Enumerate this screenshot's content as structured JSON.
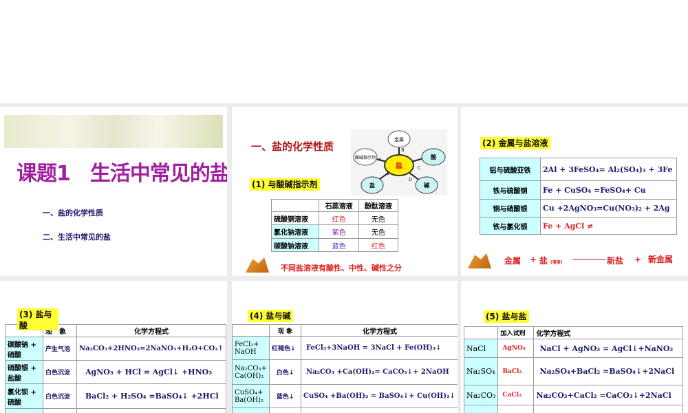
{
  "slide1": {
    "title": "课题1　生活中常见的盐",
    "items": [
      "一、盐的化学性质",
      "二、生活中常见的盐"
    ]
  },
  "slide2": {
    "title": "一、盐的化学性质",
    "label": "(1) 与酸碱指示剂",
    "diagram": {
      "center": "盐",
      "nodes": [
        "金属",
        "酸碱指示剂",
        "酸",
        "盐",
        "碱"
      ],
      "letters": [
        "A",
        "B",
        "C",
        "D",
        "E"
      ]
    },
    "table": {
      "headers": [
        "",
        "石蕊溶液",
        "酚酞溶液"
      ],
      "rows": [
        [
          "硫酸铜溶液",
          "红色",
          "无色"
        ],
        [
          "氯化钠溶液",
          "紫色",
          "无色"
        ],
        [
          "碳酸钠溶液",
          "蓝色",
          "红色"
        ]
      ]
    },
    "footer": "不同盐溶液有酸性、中性、碱性之分"
  },
  "slide3": {
    "label": "(2) 金属与盐溶液",
    "rows": [
      [
        "铝与硫酸亚铁",
        "2Al + 3FeSO₄= Al₂(SO₄)₃ + 3Fe"
      ],
      [
        "铁与硫酸铜",
        "Fe +  CuSO₄ =FeSO₄+   Cu"
      ],
      [
        "铜与硝酸银",
        "Cu +2AgNO₃=Cu(NO₃)₂ + 2Ag"
      ],
      [
        "铁与氯化银",
        "Fe + AgCl ≠"
      ]
    ],
    "footer": {
      "metal": "金属",
      "plus1": "+",
      "salt": "盐",
      "note": "(溶液)",
      "new_salt": "新盐",
      "plus2": "+",
      "new_metal": "新金属"
    }
  },
  "slide4": {
    "label": "(3) 盐与酸",
    "headers": [
      "",
      "现　象",
      "化学方程式"
    ],
    "rows": [
      [
        "碳酸钠 + 硝酸",
        "产生气泡",
        "Na₂CO₃+2HNO₃=2NaNO₃+H₂O+CO₂↑"
      ],
      [
        "硝酸银 + 盐酸",
        "白色沉淀",
        "AgNO₃ + HCl = AgCl↓ +HNO₃"
      ],
      [
        "氯化钡 + 硫酸",
        "白色沉淀",
        "BaCl₂ + H₂SO₄ =BaSO₄↓ +2HCl"
      ]
    ]
  },
  "slide5": {
    "label": "(4) 盐与碱",
    "headers": [
      "",
      "现 象",
      "化学方程式"
    ],
    "rows": [
      [
        "FeCl₃+ NaOH",
        "红褐色↓",
        "FeCl₃+3NaOH = 3NaCl + Fe(OH)₃↓"
      ],
      [
        "Na₂CO₃+ Ca(OH)₂",
        "白色↓",
        "Na₂CO₃ +Ca(OH)₂= CaCO₃↓+ 2NaOH"
      ],
      [
        "CuSO₄+ Ba(OH)₂",
        "蓝色↓",
        "CuSO₄ +Ba(OH)₂ = BaSO₄↓+ Cu(OH)₂↓"
      ]
    ]
  },
  "slide6": {
    "label": "(5) 盐与盐",
    "headers": [
      "",
      "加入试剂",
      "化学方程式"
    ],
    "rows": [
      [
        "NaCl",
        "AgNO₃",
        "NaCl + AgNO₃ = AgCl↓+NaNO₃"
      ],
      [
        "Na₂SO₄",
        "BaCl₂",
        "Na₂SO₄+BaCl₂ =BaSO₄↓+2NaCl"
      ],
      [
        "Na₂CO₃",
        "CaCl₂",
        "Na₂CO₃+CaCl₂ =CaCO₃↓+2NaCl"
      ]
    ]
  }
}
